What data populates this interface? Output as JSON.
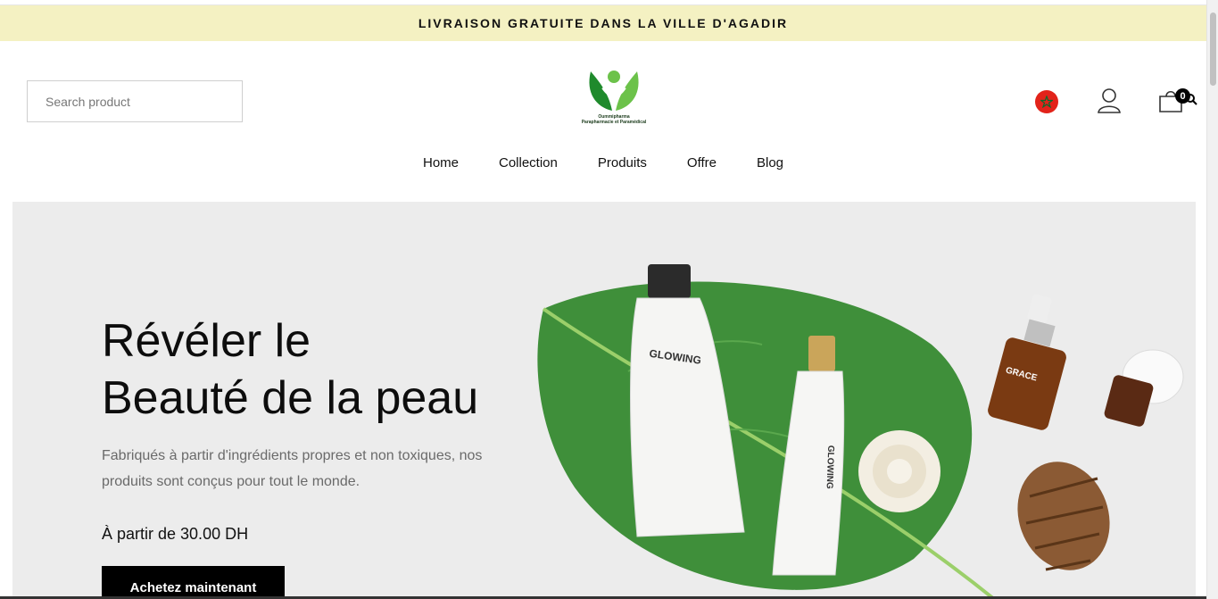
{
  "announcement": "LIVRAISON GRATUITE DANS LA VILLE D'AGADIR",
  "search": {
    "placeholder": "Search product"
  },
  "logo": {
    "name": "Oummipharma",
    "tagline": "Parapharmacie et Paramédical"
  },
  "cart": {
    "count": "0"
  },
  "nav": [
    "Home",
    "Collection",
    "Produits",
    "Offre",
    "Blog"
  ],
  "hero": {
    "title_line1": "Révéler le",
    "title_line2": "Beauté de la peau",
    "description": "Fabriqués à partir d'ingrédients propres et non toxiques, nos produits sont conçus pour tout le monde.",
    "price": "À partir de 30.00 DH",
    "cta": "Achetez maintenant",
    "product_labels": [
      "GLOWING",
      "GLOWING",
      "GRACE"
    ]
  },
  "colors": {
    "announcement_bg": "#f4f1c2",
    "hero_bg": "#ececec",
    "cta_bg": "#000000",
    "flag_red": "#e2231a",
    "logo_green": "#2e9a3a"
  },
  "icons": [
    "morocco-flag-icon",
    "user-icon",
    "cart-icon",
    "search-icon"
  ]
}
